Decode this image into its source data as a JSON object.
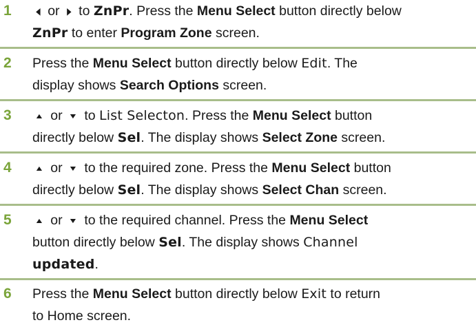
{
  "accent_color": "#7aa43a",
  "divider_color": "#a8bd8a",
  "steps": [
    {
      "num": "1",
      "line1": {
        "arrow_left": "◀",
        "or": " or ",
        "arrow_right": "▶",
        "to": " to ",
        "target": "ZnPr",
        "after": ". Press the ",
        "menu_select": "Menu Select",
        "after2": " button directly below"
      },
      "line2": {
        "target": "ZnPr",
        "mid": " to enter ",
        "screen": "Program Zone",
        "tail": " screen."
      }
    },
    {
      "num": "2",
      "line1": {
        "pre": "Press the ",
        "menu_select": "Menu Select",
        "mid": " button directly below ",
        "target": "Edit",
        "tail": ". The"
      },
      "line2": {
        "pre": "display shows ",
        "screen": "Search Options",
        "tail": " screen."
      }
    },
    {
      "num": "3",
      "line1": {
        "arrow_up": "▲",
        "or": " or ",
        "arrow_down": "▼",
        "to": " to ",
        "target": "List Selecton",
        "mid": ". Press the ",
        "menu_select": "Menu Select",
        "tail": " button"
      },
      "line2": {
        "pre": "directly below ",
        "target": "Sel",
        "mid": ". The display shows ",
        "screen": "Select Zone",
        "tail": " screen."
      }
    },
    {
      "num": "4",
      "line1": {
        "arrow_up": "▲",
        "or": " or ",
        "arrow_down": "▼",
        "mid": " to the required zone. Press the ",
        "menu_select": "Menu Select",
        "tail": " button"
      },
      "line2": {
        "pre": "directly below ",
        "target": "Sel",
        "mid": ". The display shows ",
        "screen": "Select Chan",
        "tail": " screen."
      }
    },
    {
      "num": "5",
      "line1": {
        "arrow_up": "▲",
        "or": " or ",
        "arrow_down": "▼",
        "mid": " to the required channel. Press the ",
        "menu_select": "Menu Select"
      },
      "line2": {
        "pre": "button directly below ",
        "target": "Sel",
        "mid": ". The display shows ",
        "lcd": "Channel"
      },
      "line3": {
        "lcd": "updated",
        "tail": "."
      }
    },
    {
      "num": "6",
      "line1": {
        "pre": "Press the ",
        "menu_select": "Menu Select",
        "mid": " button directly below ",
        "target": "Exit",
        "tail": " to return"
      },
      "line2": {
        "text": "to Home screen."
      }
    }
  ]
}
